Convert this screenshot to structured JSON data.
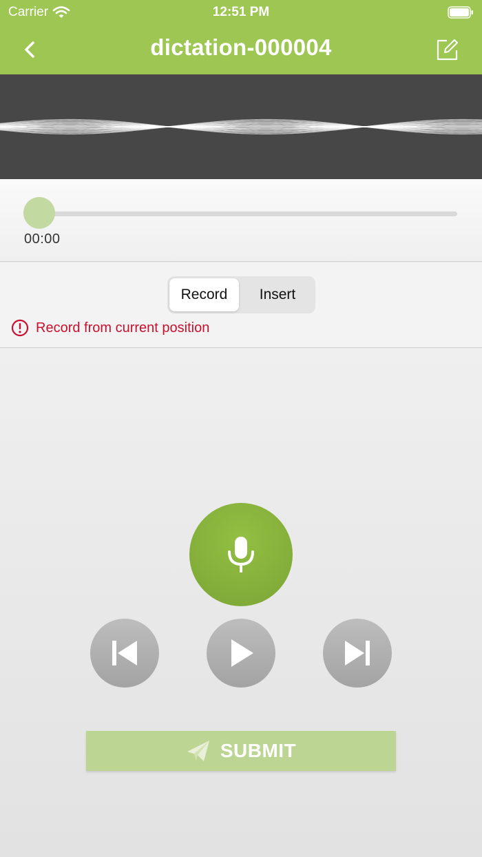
{
  "status_bar": {
    "carrier": "Carrier",
    "time": "12:51 PM",
    "wifi_icon": "wifi-icon",
    "battery_icon": "battery-icon"
  },
  "nav": {
    "title": "dictation-000004",
    "back_icon": "chevron-left-icon",
    "edit_icon": "edit-icon"
  },
  "player": {
    "position": 0,
    "time": "00:00"
  },
  "mode": {
    "options": [
      "Record",
      "Insert"
    ],
    "selected": "Record",
    "hint": "Record from current position",
    "hint_icon": "info-circle-icon"
  },
  "controls": {
    "record_icon": "microphone-icon",
    "prev_icon": "skip-back-icon",
    "play_icon": "play-icon",
    "next_icon": "skip-forward-icon",
    "submit_label": "SUBMIT",
    "submit_icon": "paper-plane-icon"
  },
  "colors": {
    "header": "#9dc653",
    "record_button": "#86b23c",
    "submit_button": "#bcd593",
    "hint": "#c8102e",
    "waveform_background": "#474747"
  }
}
